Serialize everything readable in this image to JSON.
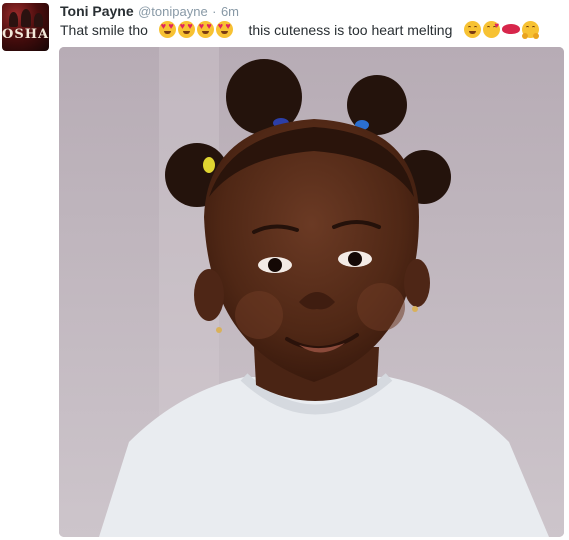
{
  "tweet": {
    "author_name": "Toni Payne",
    "handle": "@tonipayne",
    "separator": "·",
    "time": "6m",
    "text_part1": "That smile tho",
    "text_part2": "this cuteness is too heart melting"
  },
  "avatar": {
    "logo_text": "OSHA"
  },
  "emojis": {
    "first_group": [
      "heart-eyes",
      "heart-eyes",
      "heart-eyes",
      "heart-eyes"
    ],
    "second_group": [
      "smiling-face",
      "kissing-face",
      "kiss-lips",
      "hugging-face"
    ]
  },
  "colors": {
    "name": "#292f33",
    "meta": "#8899a6",
    "photo_background": "#c5bcc4"
  }
}
